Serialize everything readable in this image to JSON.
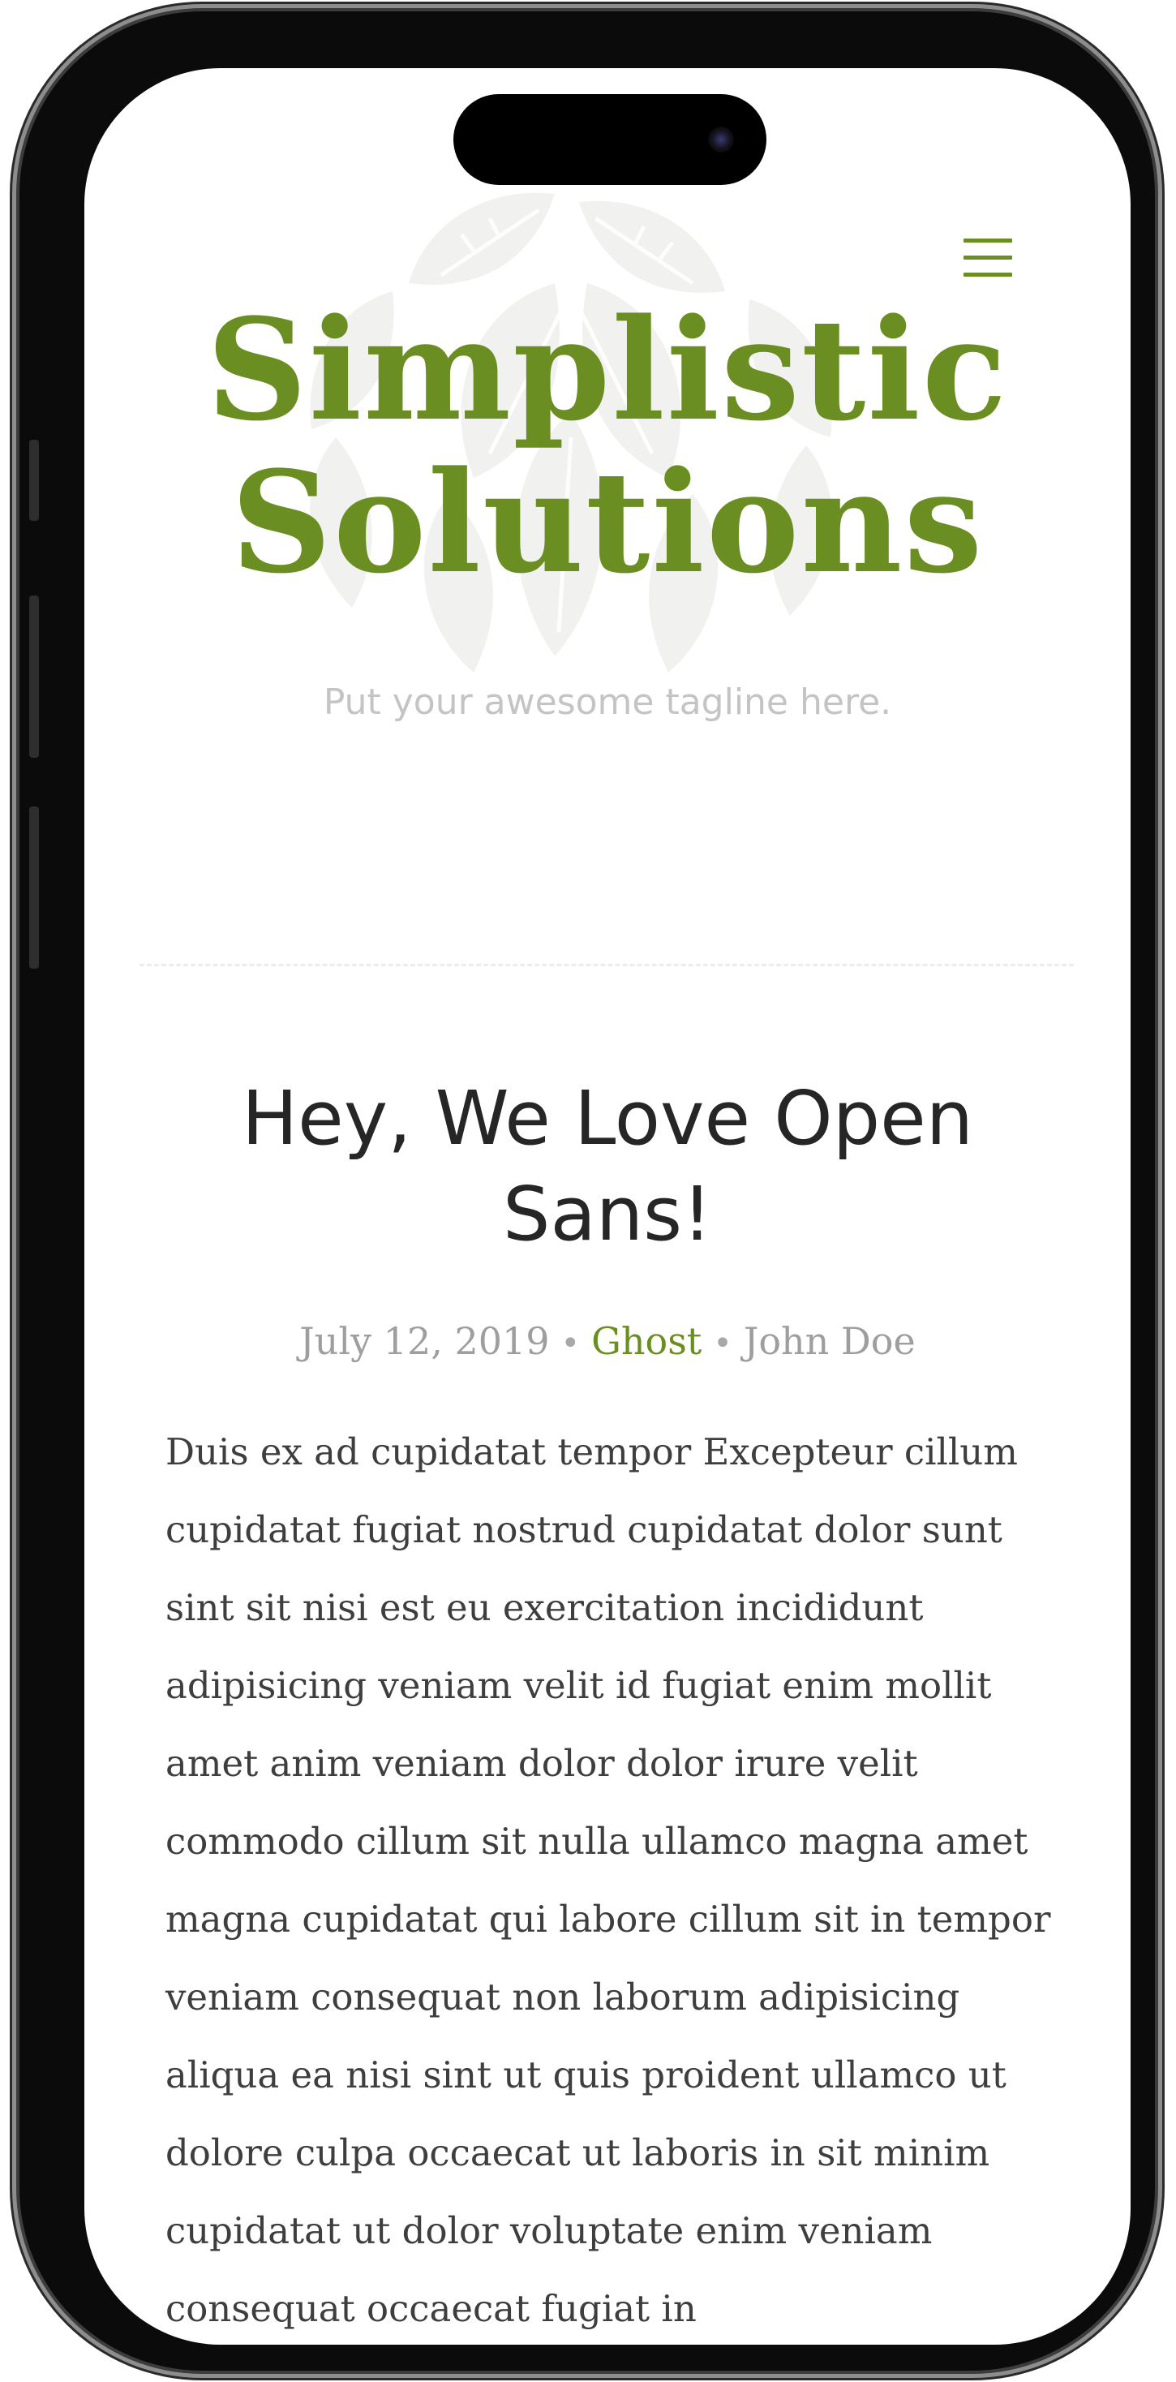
{
  "site": {
    "title_line1": "Simplistic",
    "title_line2": "Solutions",
    "tagline": "Put your awesome tagline here.",
    "accent_color": "#6b8e23"
  },
  "header": {
    "menu_icon": "hamburger-menu-icon",
    "logo_bg_icon": "leaf-watermark-icon"
  },
  "post": {
    "title": "Hey, We Love Open Sans!",
    "date": "July 12, 2019",
    "separator": "•",
    "tag": "Ghost",
    "author": "John Doe",
    "excerpt": "Duis ex ad cupidatat tempor Excepteur cillum cupidatat fugiat nostrud cupidatat dolor sunt sint sit nisi est eu exercitation incididunt adipisicing veniam velit id fugiat enim mollit amet anim veniam dolor dolor irure velit commodo cillum sit nulla ullamco magna amet magna cupidatat qui labore cillum sit in tempor veniam consequat non laborum adipisicing aliqua ea nisi sint ut quis proident ullamco ut dolore culpa occaecat ut laboris in sit minim cupidatat ut dolor voluptate enim veniam consequat occaecat fugiat in"
  }
}
